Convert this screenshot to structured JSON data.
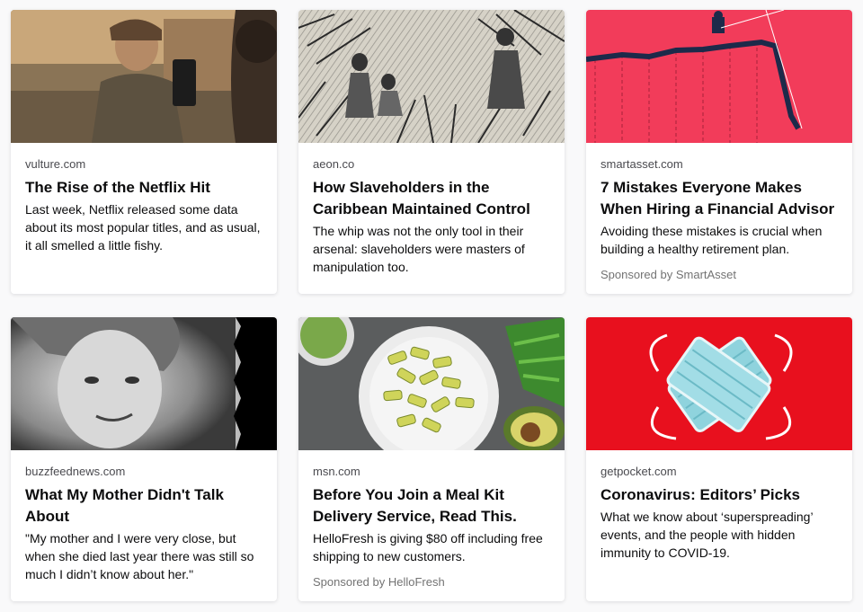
{
  "cards": [
    {
      "source": "vulture.com",
      "title": "The Rise of the Netflix Hit",
      "excerpt": "Last week, Netflix released some data about its most popular titles, and as usual, it all smelled a little fishy.",
      "sponsor": ""
    },
    {
      "source": "aeon.co",
      "title": "How Slaveholders in the Caribbean Maintained Control",
      "excerpt": "The whip was not the only tool in their arsenal: slaveholders were masters of manipulation too.",
      "sponsor": ""
    },
    {
      "source": "smartasset.com",
      "title": "7 Mistakes Everyone Makes When Hiring a Financial Advisor",
      "excerpt": "Avoiding these mistakes is crucial when building a healthy retirement plan.",
      "sponsor": "Sponsored by SmartAsset"
    },
    {
      "source": "buzzfeednews.com",
      "title": "What My Mother Didn't Talk About",
      "excerpt": "\"My mother and I were very close, but when she died last year there was still so much I didn’t know about her.\"",
      "sponsor": ""
    },
    {
      "source": "msn.com",
      "title": "Before You Join a Meal Kit Delivery Service, Read This.",
      "excerpt": "HelloFresh is giving $80 off including free shipping to new customers.",
      "sponsor": "Sponsored by HelloFresh"
    },
    {
      "source": "getpocket.com",
      "title": "Coronavirus: Editors’ Picks",
      "excerpt": "What we know about ‘superspreading’ events, and the people with hidden immunity to COVID-19.",
      "sponsor": ""
    }
  ],
  "colors": {
    "page_bg": "#f9f9fa",
    "card_bg": "#ffffff",
    "source_text": "#4a4a4f",
    "sponsor_text": "#737373",
    "smartasset_bg": "#f23c5a",
    "getpocket_bg": "#e8101e"
  }
}
